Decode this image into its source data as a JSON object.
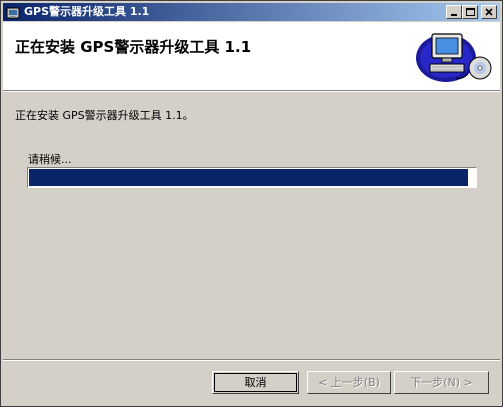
{
  "window": {
    "title": "GPS警示器升级工具 1.1"
  },
  "banner": {
    "title": "正在安装 GPS警示器升级工具 1.1"
  },
  "body": {
    "status": "正在安装 GPS警示器升级工具 1.1。",
    "wait": "请稍候..."
  },
  "progress": {
    "fraction": 0.985
  },
  "buttons": {
    "cancel": "取消",
    "back": "< 上一步(B)",
    "next": "下一步(N) >"
  },
  "icons": {
    "title_icon": "installer-icon",
    "banner_art": "computer-disc-icon"
  },
  "colors": {
    "titlebar_start": "#0a246a",
    "titlebar_end": "#a6caf0",
    "progress_fill": "#0a246a",
    "dialog_bg": "#d4d0c8"
  }
}
